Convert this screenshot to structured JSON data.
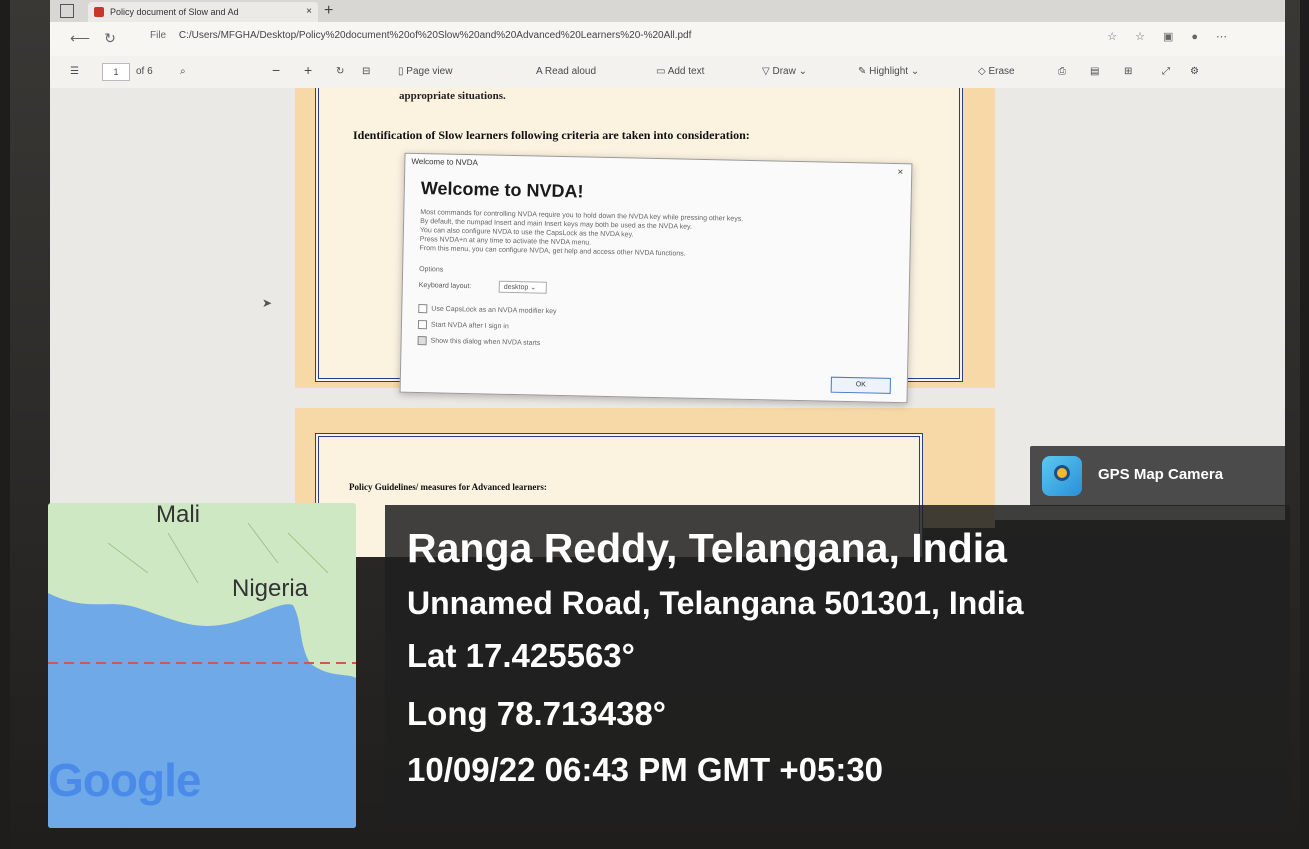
{
  "browser": {
    "tab_title": "Policy document of Slow and Ad",
    "tab_close": "×",
    "new_tab": "+",
    "file_label": "File",
    "url": "C:/Users/MFGHA/Desktop/Policy%20document%20of%20Slow%20and%20Advanced%20Learners%20-%20All.pdf"
  },
  "pdf_toolbar": {
    "page_number": "1",
    "page_of": "of 6",
    "page_view": "Page view",
    "read_aloud": "Read aloud",
    "add_text": "Add text",
    "draw": "Draw",
    "highlight": "Highlight",
    "erase": "Erase"
  },
  "document": {
    "line_top": "appropriate situations.",
    "identification": "Identification of Slow learners following criteria are taken into consideration:",
    "page2_heading": "Policy Guidelines/ measures for Advanced learners:"
  },
  "dialog": {
    "window_title": "Welcome to NVDA",
    "close": "×",
    "heading": "Welcome to NVDA!",
    "body_lines": [
      "Most commands for controlling NVDA require you to hold down the NVDA key while pressing other keys.",
      "By default, the numpad Insert and main Insert keys may both be used as the NVDA key.",
      "You can also configure NVDA to use the CapsLock as the NVDA key.",
      "Press NVDA+n at any time to activate the NVDA menu.",
      "From this menu, you can configure NVDA, get help and access other NVDA functions."
    ],
    "options_label": "Options",
    "keyboard_layout_label": "Keyboard layout:",
    "keyboard_layout_value": "desktop",
    "checkbox_capslock": "Use CapsLock as an NVDA modifier key",
    "checkbox_startup": "Start NVDA after I sign in",
    "checkbox_show": "Show this dialog when NVDA starts",
    "ok": "OK"
  },
  "gps": {
    "app_name": "GPS Map Camera",
    "location": "Ranga Reddy, Telangana, India",
    "address": "Unnamed Road, Telangana 501301, India",
    "lat": "Lat 17.425563°",
    "long": "Long 78.713438°",
    "datetime": "10/09/22 06:43 PM GMT +05:30"
  },
  "map": {
    "label_mali": "Mali",
    "label_nigeria": "Nigeria",
    "google": "Google",
    "colors": {
      "land": "#cfe8c4",
      "water": "#6fa9e8",
      "equator": "#d9534f"
    }
  }
}
